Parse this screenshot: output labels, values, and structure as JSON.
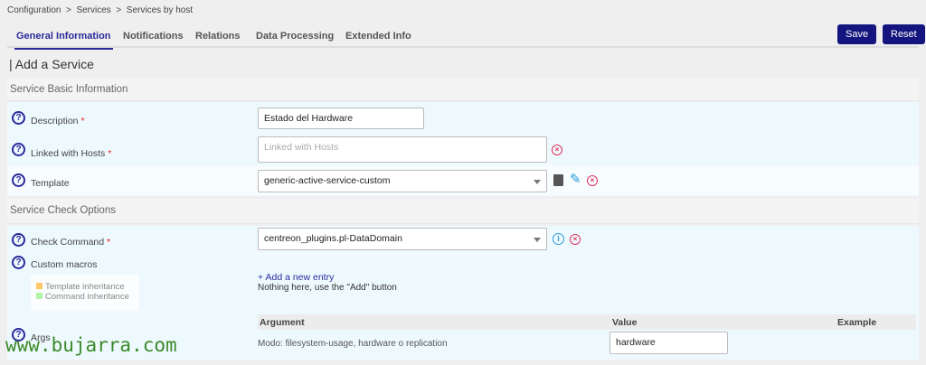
{
  "breadcrumb": [
    "Configuration",
    ">",
    "Services",
    ">",
    "Services by host"
  ],
  "tabs": [
    "General Information",
    "Notifications",
    "Relations",
    "Data Processing",
    "Extended Info"
  ],
  "buttons": {
    "save": "Save",
    "reset": "Reset"
  },
  "title": "| Add a Service",
  "sections": {
    "basic": "Service Basic Information",
    "check": "Service Check Options"
  },
  "fields": {
    "description": {
      "label": "Description",
      "required": "*",
      "value": "Estado del Hardware"
    },
    "linked_hosts": {
      "label": "Linked with Hosts",
      "required": "*",
      "placeholder": "Linked with Hosts"
    },
    "template": {
      "label": "Template",
      "value": "generic-active-service-custom"
    },
    "check_command": {
      "label": "Check Command",
      "required": "*",
      "value": "centreon_plugins.pl-DataDomain"
    },
    "custom_macros": {
      "label": "Custom macros",
      "add_entry": "+ Add a new entry",
      "empty": "Nothing here, use the \"Add\" button",
      "legend": [
        "Template inheritance",
        "Command inheritance"
      ]
    },
    "args": {
      "label": "Args",
      "headers": [
        "Argument",
        "Value",
        "Example"
      ],
      "rows": [
        {
          "argument": "Modo: filesystem-usage, hardware o replication",
          "value": "hardware"
        }
      ]
    }
  },
  "colors": {
    "accent": "#15157f",
    "template_inheritance": "#ffc866",
    "command_inheritance": "#b3f5a6"
  },
  "watermark": "www.bujarra.com"
}
